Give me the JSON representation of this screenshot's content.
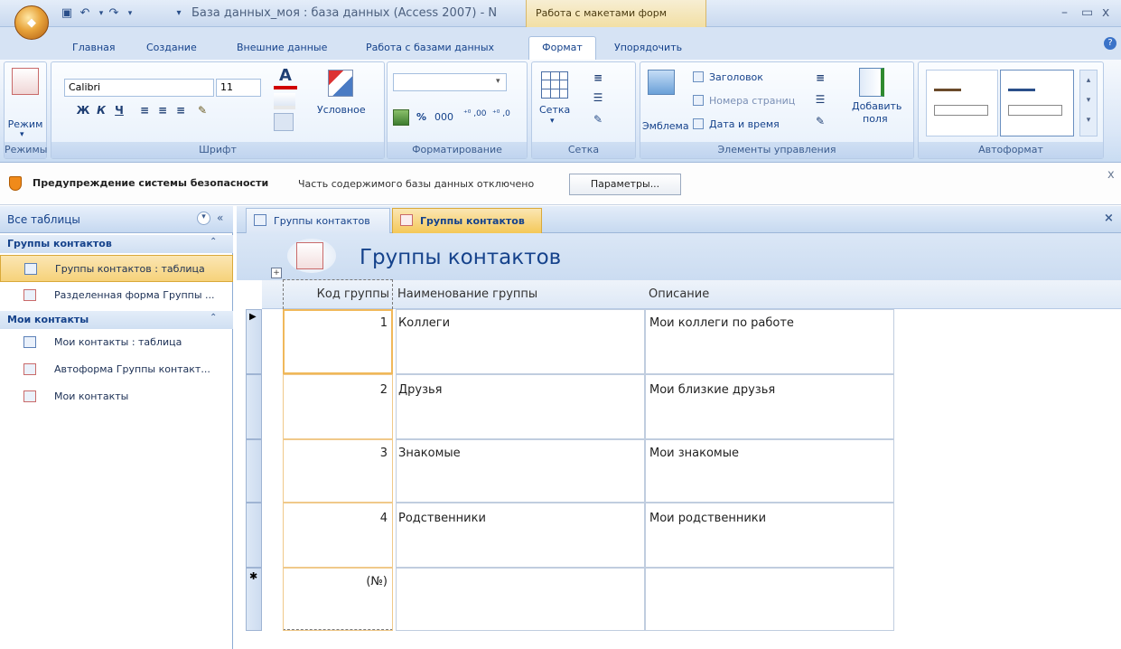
{
  "title_bar": {
    "window_title": "База данных_моя : база данных (Access 2007) - N",
    "context_tab": "Работа с макетами форм",
    "office_button": "Office"
  },
  "ribbon_tabs": [
    "Главная",
    "Создание",
    "Внешние данные",
    "Работа с базами данных",
    "Формат",
    "Упорядочить"
  ],
  "ribbon": {
    "views": {
      "button": "Режим",
      "caption": "Режимы"
    },
    "font": {
      "name": "Calibri",
      "size": "11",
      "bold": "Ж",
      "italic": "К",
      "underline": "Ч",
      "conditional": "Условное",
      "caption": "Шрифт"
    },
    "formatting": {
      "percent": "%",
      "thousands": "000",
      "caption": "Форматирование"
    },
    "grid": {
      "button": "Сетка",
      "caption": "Сетка"
    },
    "controls": {
      "logo": "Эмблема",
      "title": "Заголовок",
      "page_numbers": "Номера страниц",
      "date_time": "Дата и время",
      "add_fields_1": "Добавить",
      "add_fields_2": "поля",
      "caption": "Элементы управления"
    },
    "autoformat": {
      "caption": "Автоформат"
    }
  },
  "security_bar": {
    "title": "Предупреждение системы безопасности",
    "message": "Часть содержимого базы данных отключено",
    "button": "Параметры..."
  },
  "nav_pane": {
    "header": "Все таблицы",
    "groups": [
      {
        "label": "Группы контактов",
        "items": [
          {
            "label": "Группы контактов : таблица",
            "type": "table"
          },
          {
            "label": "Разделенная форма Группы ...",
            "type": "form"
          }
        ]
      },
      {
        "label": "Мои контакты",
        "items": [
          {
            "label": "Мои контакты : таблица",
            "type": "table"
          },
          {
            "label": "Автоформа Группы контакт...",
            "type": "form"
          },
          {
            "label": "Мои контакты",
            "type": "form"
          }
        ]
      }
    ]
  },
  "doc_tabs": [
    {
      "label": "Группы контактов",
      "active": false
    },
    {
      "label": "Группы контактов",
      "active": true
    }
  ],
  "form": {
    "title": "Группы контактов",
    "columns": [
      "Код группы",
      "Наименование группы",
      "Описание"
    ],
    "rows": [
      {
        "id": "1",
        "name": "Коллеги",
        "desc": "Мои коллеги по работе"
      },
      {
        "id": "2",
        "name": "Друзья",
        "desc": "Мои близкие друзья"
      },
      {
        "id": "3",
        "name": "Знакомые",
        "desc": "Мои знакомые"
      },
      {
        "id": "4",
        "name": "Родственники",
        "desc": "Мои родственники"
      }
    ],
    "new_row": "(№)",
    "current_row_marker": "▶",
    "new_row_marker": "✱"
  }
}
